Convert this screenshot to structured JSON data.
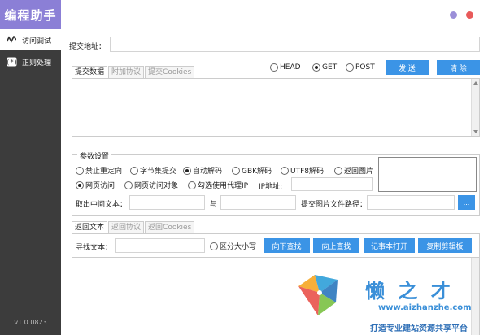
{
  "app": {
    "title": "编程助手",
    "version": "v1.0.0823"
  },
  "sidebar": {
    "items": [
      {
        "label": "访问调试",
        "icon": "wave-icon",
        "active": true
      },
      {
        "label": "正则处理",
        "icon": "regex-icon",
        "active": false
      }
    ]
  },
  "window_controls": {
    "dot1_color": "#9b8fd8",
    "dot2_color": "#e85a5a"
  },
  "request": {
    "url_label": "提交地址：",
    "url_value": "",
    "tabs": [
      "提交数据",
      "附加协议",
      "提交Cookies"
    ],
    "methods": [
      "HEAD",
      "GET",
      "POST"
    ],
    "selected_method": "GET",
    "send_label": "发 送",
    "clear_label": "清 除"
  },
  "params": {
    "title": "参数设置",
    "row1": [
      {
        "label": "禁止重定向",
        "checked": false
      },
      {
        "label": "字节集提交",
        "checked": false
      },
      {
        "label": "自动解码",
        "checked": true
      },
      {
        "label": "GBK解码",
        "checked": false
      },
      {
        "label": "UTF8解码",
        "checked": false
      },
      {
        "label": "返回图片",
        "checked": false
      }
    ],
    "row2": [
      {
        "label": "网页访问",
        "checked": true
      },
      {
        "label": "网页访问对象",
        "checked": false
      },
      {
        "label": "勾选使用代理IP",
        "checked": false
      }
    ],
    "ip_label": "IP地址:",
    "ip_value": "",
    "extract_label": "取出中间文本：",
    "and_label": "与",
    "image_path_label": "提交图片文件路径：",
    "browse_label": "..."
  },
  "response": {
    "tabs": [
      "返回文本",
      "返回协议",
      "返回Cookies"
    ],
    "find_label": "寻找文本：",
    "find_value": "",
    "case_label": "区分大小写",
    "find_down_label": "向下查找",
    "find_up_label": "向上查找",
    "notepad_label": "记事本打开",
    "copy_label": "复制剪辑板"
  },
  "watermark": {
    "title": "懒 之 才",
    "url": "www.aizhanzhe.com",
    "slogan": "打造专业建站资源共享平台"
  },
  "colors": {
    "accent": "#3b94e6",
    "logo_bg": "#8b7fd6",
    "sidebar_bg": "#3c3c3c"
  }
}
